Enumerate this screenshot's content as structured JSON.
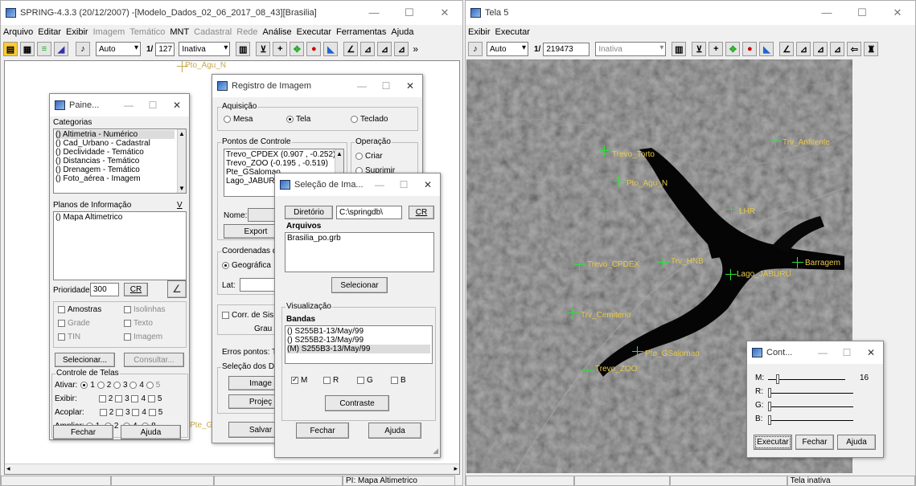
{
  "left_window": {
    "title": "SPRING-4.3.3 (20/12/2007) -[Modelo_Dados_02_06_2017_08_43][Brasilia]",
    "menu": [
      {
        "label": "Arquivo",
        "disabled": false
      },
      {
        "label": "Editar",
        "disabled": false
      },
      {
        "label": "Exibir",
        "disabled": false
      },
      {
        "label": "Imagem",
        "disabled": true
      },
      {
        "label": "Temático",
        "disabled": true
      },
      {
        "label": "MNT",
        "disabled": false
      },
      {
        "label": "Cadastral",
        "disabled": true
      },
      {
        "label": "Rede",
        "disabled": true
      },
      {
        "label": "Análise",
        "disabled": false
      },
      {
        "label": "Executar",
        "disabled": false
      },
      {
        "label": "Ferramentas",
        "disabled": false
      },
      {
        "label": "Ajuda",
        "disabled": false
      }
    ],
    "toolbar": {
      "mode": "Auto",
      "scale_prefix": "1/",
      "scale": "127",
      "state": "Inativa",
      "more": "»"
    },
    "canvas_labels": {
      "top": "Pto_Agu_N",
      "bottom": "Pte_G"
    },
    "status": {
      "plan": "PI: Mapa Altimetrico"
    }
  },
  "right_window": {
    "title": "Tela 5",
    "menu": [
      {
        "label": "Exibir"
      },
      {
        "label": "Executar"
      }
    ],
    "toolbar": {
      "mode": "Auto",
      "scale_prefix": "1/",
      "scale": "219473",
      "state": "Inativa"
    },
    "image_labels": [
      "Trevo_Torto",
      "Trv_Anfitente",
      "Pto_Agu_N",
      "LHR",
      "Trevo_CPDEX",
      "Trv_HNB",
      "Barragem",
      "Lago_JABURU",
      "Trv_Cemiterio",
      "Pte_GSalomao",
      "Trevo_ZOO"
    ],
    "status": {
      "state": "Tela inativa"
    }
  },
  "painel": {
    "title": "Paine...",
    "categorias_label": "Categorias",
    "categorias": [
      "() Altimetria - Numérico",
      "() Cad_Urbano - Cadastral",
      "() Declividade - Temático",
      "() Distancias - Temático",
      "() Drenagem - Temático",
      "() Foto_aérea - Imagem"
    ],
    "planos_label": "Planos de Informação",
    "planos_v": "V",
    "planos": [
      "() Mapa Altimetrico"
    ],
    "prioridade_label": "Prioridade:",
    "prioridade": "300",
    "cr": "CR",
    "checks": {
      "amostras": "Amostras",
      "isolinhas": "Isolinhas",
      "grade": "Grade",
      "texto": "Texto",
      "tin": "TIN",
      "imagem": "Imagem"
    },
    "selecionar": "Selecionar...",
    "consultar": "Consultar...",
    "controle_label": "Controle de Telas",
    "ativar": "Ativar:",
    "exibir": "Exibir:",
    "acoplar": "Acoplar:",
    "ampliar": "Ampliar:",
    "n1": "1",
    "n2": "2",
    "n3": "3",
    "n4": "4",
    "n5": "5",
    "n8": "8",
    "fechar": "Fechar",
    "ajuda": "Ajuda"
  },
  "registro": {
    "title": "Registro de Imagem",
    "aquisicao": "Aquisição",
    "mesa": "Mesa",
    "tela": "Tela",
    "teclado": "Teclado",
    "pontos_label": "Pontos de Controle",
    "pontos": [
      "Trevo_CPDEX (0.907 , -0.252)",
      "Trevo_ZOO (-0.195 , -0.519)",
      "Pte_GSalomao",
      "Lago_JABURU"
    ],
    "operacao": "Operação",
    "criar": "Criar",
    "suprimir": "Suprimir",
    "nome": "Nome:",
    "export": "Export",
    "coordenadas": "Coordenadas de",
    "geografica": "Geográfica",
    "lat": "Lat:",
    "corr": "Corr. de Sis",
    "grau": "Grau d",
    "erros": "Erros pontos: T",
    "selecao_dos": "Seleção dos Da",
    "image_btn": "Image",
    "projec_btn": "Projeç",
    "salvar": "Salvar"
  },
  "selecao": {
    "title": "Seleção de Ima...",
    "diretorio_btn": "Diretório",
    "diretorio": "C:\\springdb\\",
    "cr": "CR",
    "arquivos": "Arquivos",
    "arquivos_list": [
      "Brasilia_po.grb"
    ],
    "selecionar": "Selecionar",
    "visualizacao": "Visualização",
    "bandas": "Bandas",
    "bandas_list": [
      "() S255B1-13/May/99",
      "() S255B2-13/May/99",
      "(M) S255B3-13/May/99"
    ],
    "m": "M",
    "r": "R",
    "g": "G",
    "b": "B",
    "contraste": "Contraste",
    "fechar": "Fechar",
    "ajuda": "Ajuda"
  },
  "contraste": {
    "title": "Cont...",
    "m": "M:",
    "r": "R:",
    "g": "G:",
    "b": "B:",
    "m_value": "16",
    "executar": "Executar",
    "fechar": "Fechar",
    "ajuda": "Ajuda"
  }
}
